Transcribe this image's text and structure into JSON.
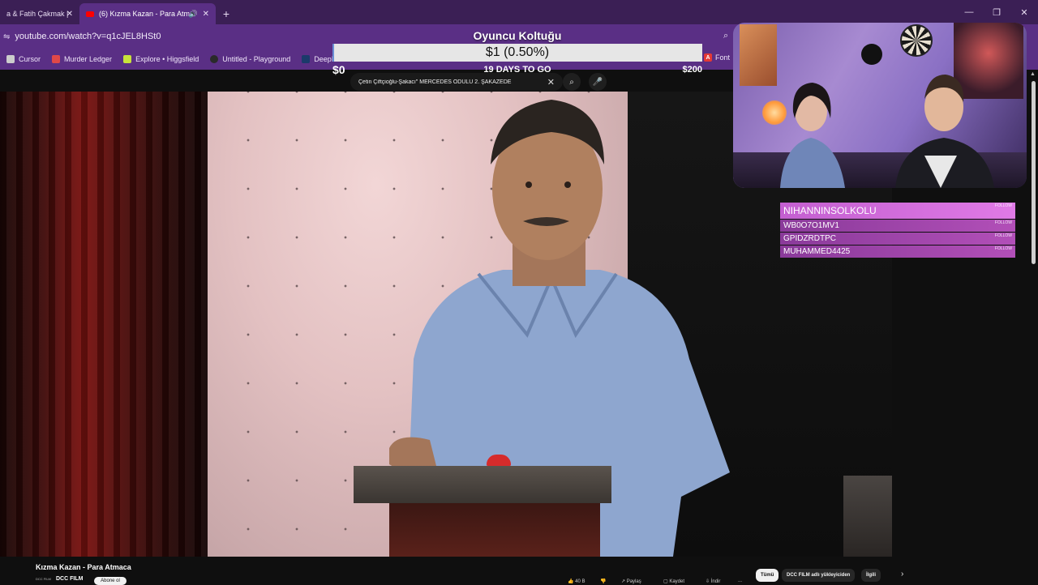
{
  "browser": {
    "tabs": [
      {
        "label": "a & Fatih Çakmak |",
        "active": false
      },
      {
        "label": "(6) Kızma Kazan - Para Atm",
        "active": true
      }
    ],
    "new_tab": "+",
    "url": "youtube.com/watch?v=q1cJEL8HSt0",
    "bookmarks": [
      {
        "label": "Cursor",
        "icon": "cursor-icon",
        "color": "#cccccc"
      },
      {
        "label": "Murder Ledger",
        "icon": "ledger-icon",
        "color": "#e04848"
      },
      {
        "label": "Explore • Higgsfield",
        "icon": "higgsfield-icon",
        "color": "#c8e23a"
      },
      {
        "label": "Untitled - Playground",
        "icon": "playground-icon",
        "color": "#2a2a2a"
      },
      {
        "label": "DeepL Tr",
        "icon": "deepl-icon",
        "color": "#1b3a6b"
      }
    ],
    "bookmark_font": {
      "label": "Font",
      "icon": "A"
    }
  },
  "goal": {
    "title": "Oyuncu Koltuğu",
    "amount": "$1 (0.50%)",
    "progress_percent": 0.5,
    "min": "$0",
    "max": "$200",
    "days": "19 DAYS TO GO"
  },
  "youtube": {
    "search_query": "Çetin Çiftçioğlu-Şakacı\" MERCEDES ÖDÜLÜ 2. ŞAKAZEDE",
    "video_title": "Kızma Kazan - Para Atmaca",
    "channel": "DCC FILM",
    "channel_logo": "DCC FILM",
    "subscribe": "Abone ol",
    "actions": [
      "40 B",
      "",
      "Paylaş",
      "Kaydet",
      "İndir",
      "..."
    ],
    "chips": [
      {
        "label": "Tümü",
        "selected": true
      },
      {
        "label": "DCC FILM adlı yükleyiciden",
        "selected": false
      },
      {
        "label": "İlgili",
        "selected": false
      }
    ]
  },
  "followers": [
    {
      "name": "NIHANNINSOLKOLU",
      "tag": "FOLLOW"
    },
    {
      "name": "WB0O7O1MV1",
      "tag": "FOLLOW"
    },
    {
      "name": "GPIDZRDTPC",
      "tag": "FOLLOW"
    },
    {
      "name": "MUHAMMED4425",
      "tag": "FOLLOW"
    }
  ]
}
